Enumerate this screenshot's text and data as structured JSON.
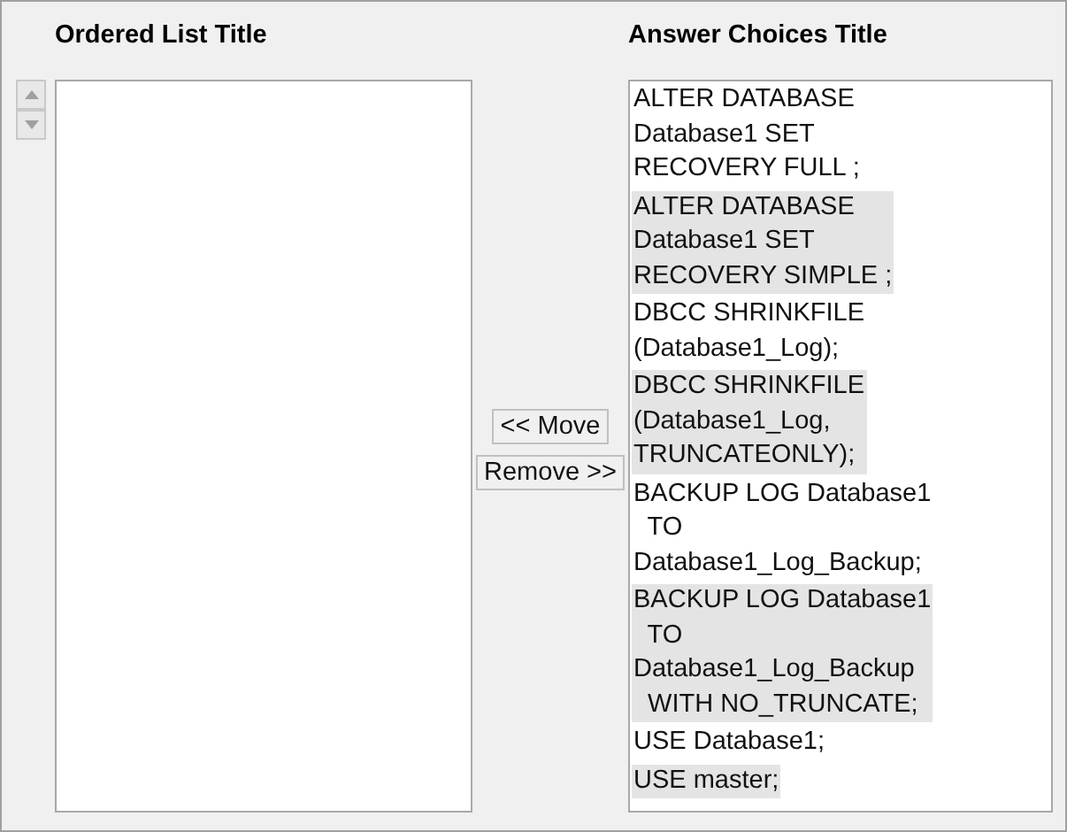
{
  "ordered_list": {
    "title": "Ordered List Title"
  },
  "move_buttons": [
    {
      "label": "<< Move"
    },
    {
      "label": "Remove >>"
    }
  ],
  "answer_choices": {
    "title": "Answer Choices Title",
    "items": [
      {
        "text": "ALTER DATABASE\nDatabase1 SET\nRECOVERY FULL ;"
      },
      {
        "text": "ALTER DATABASE\nDatabase1 SET\nRECOVERY SIMPLE ;"
      },
      {
        "text": "DBCC SHRINKFILE\n(Database1_Log);"
      },
      {
        "text": "DBCC SHRINKFILE\n(Database1_Log,\nTRUNCATEONLY);"
      },
      {
        "text": "BACKUP LOG Database1\n  TO\nDatabase1_Log_Backup;"
      },
      {
        "text": "BACKUP LOG Database1\n  TO\nDatabase1_Log_Backup\n  WITH NO_TRUNCATE;"
      },
      {
        "text": "USE Database1;"
      },
      {
        "text": "USE master;"
      }
    ]
  }
}
